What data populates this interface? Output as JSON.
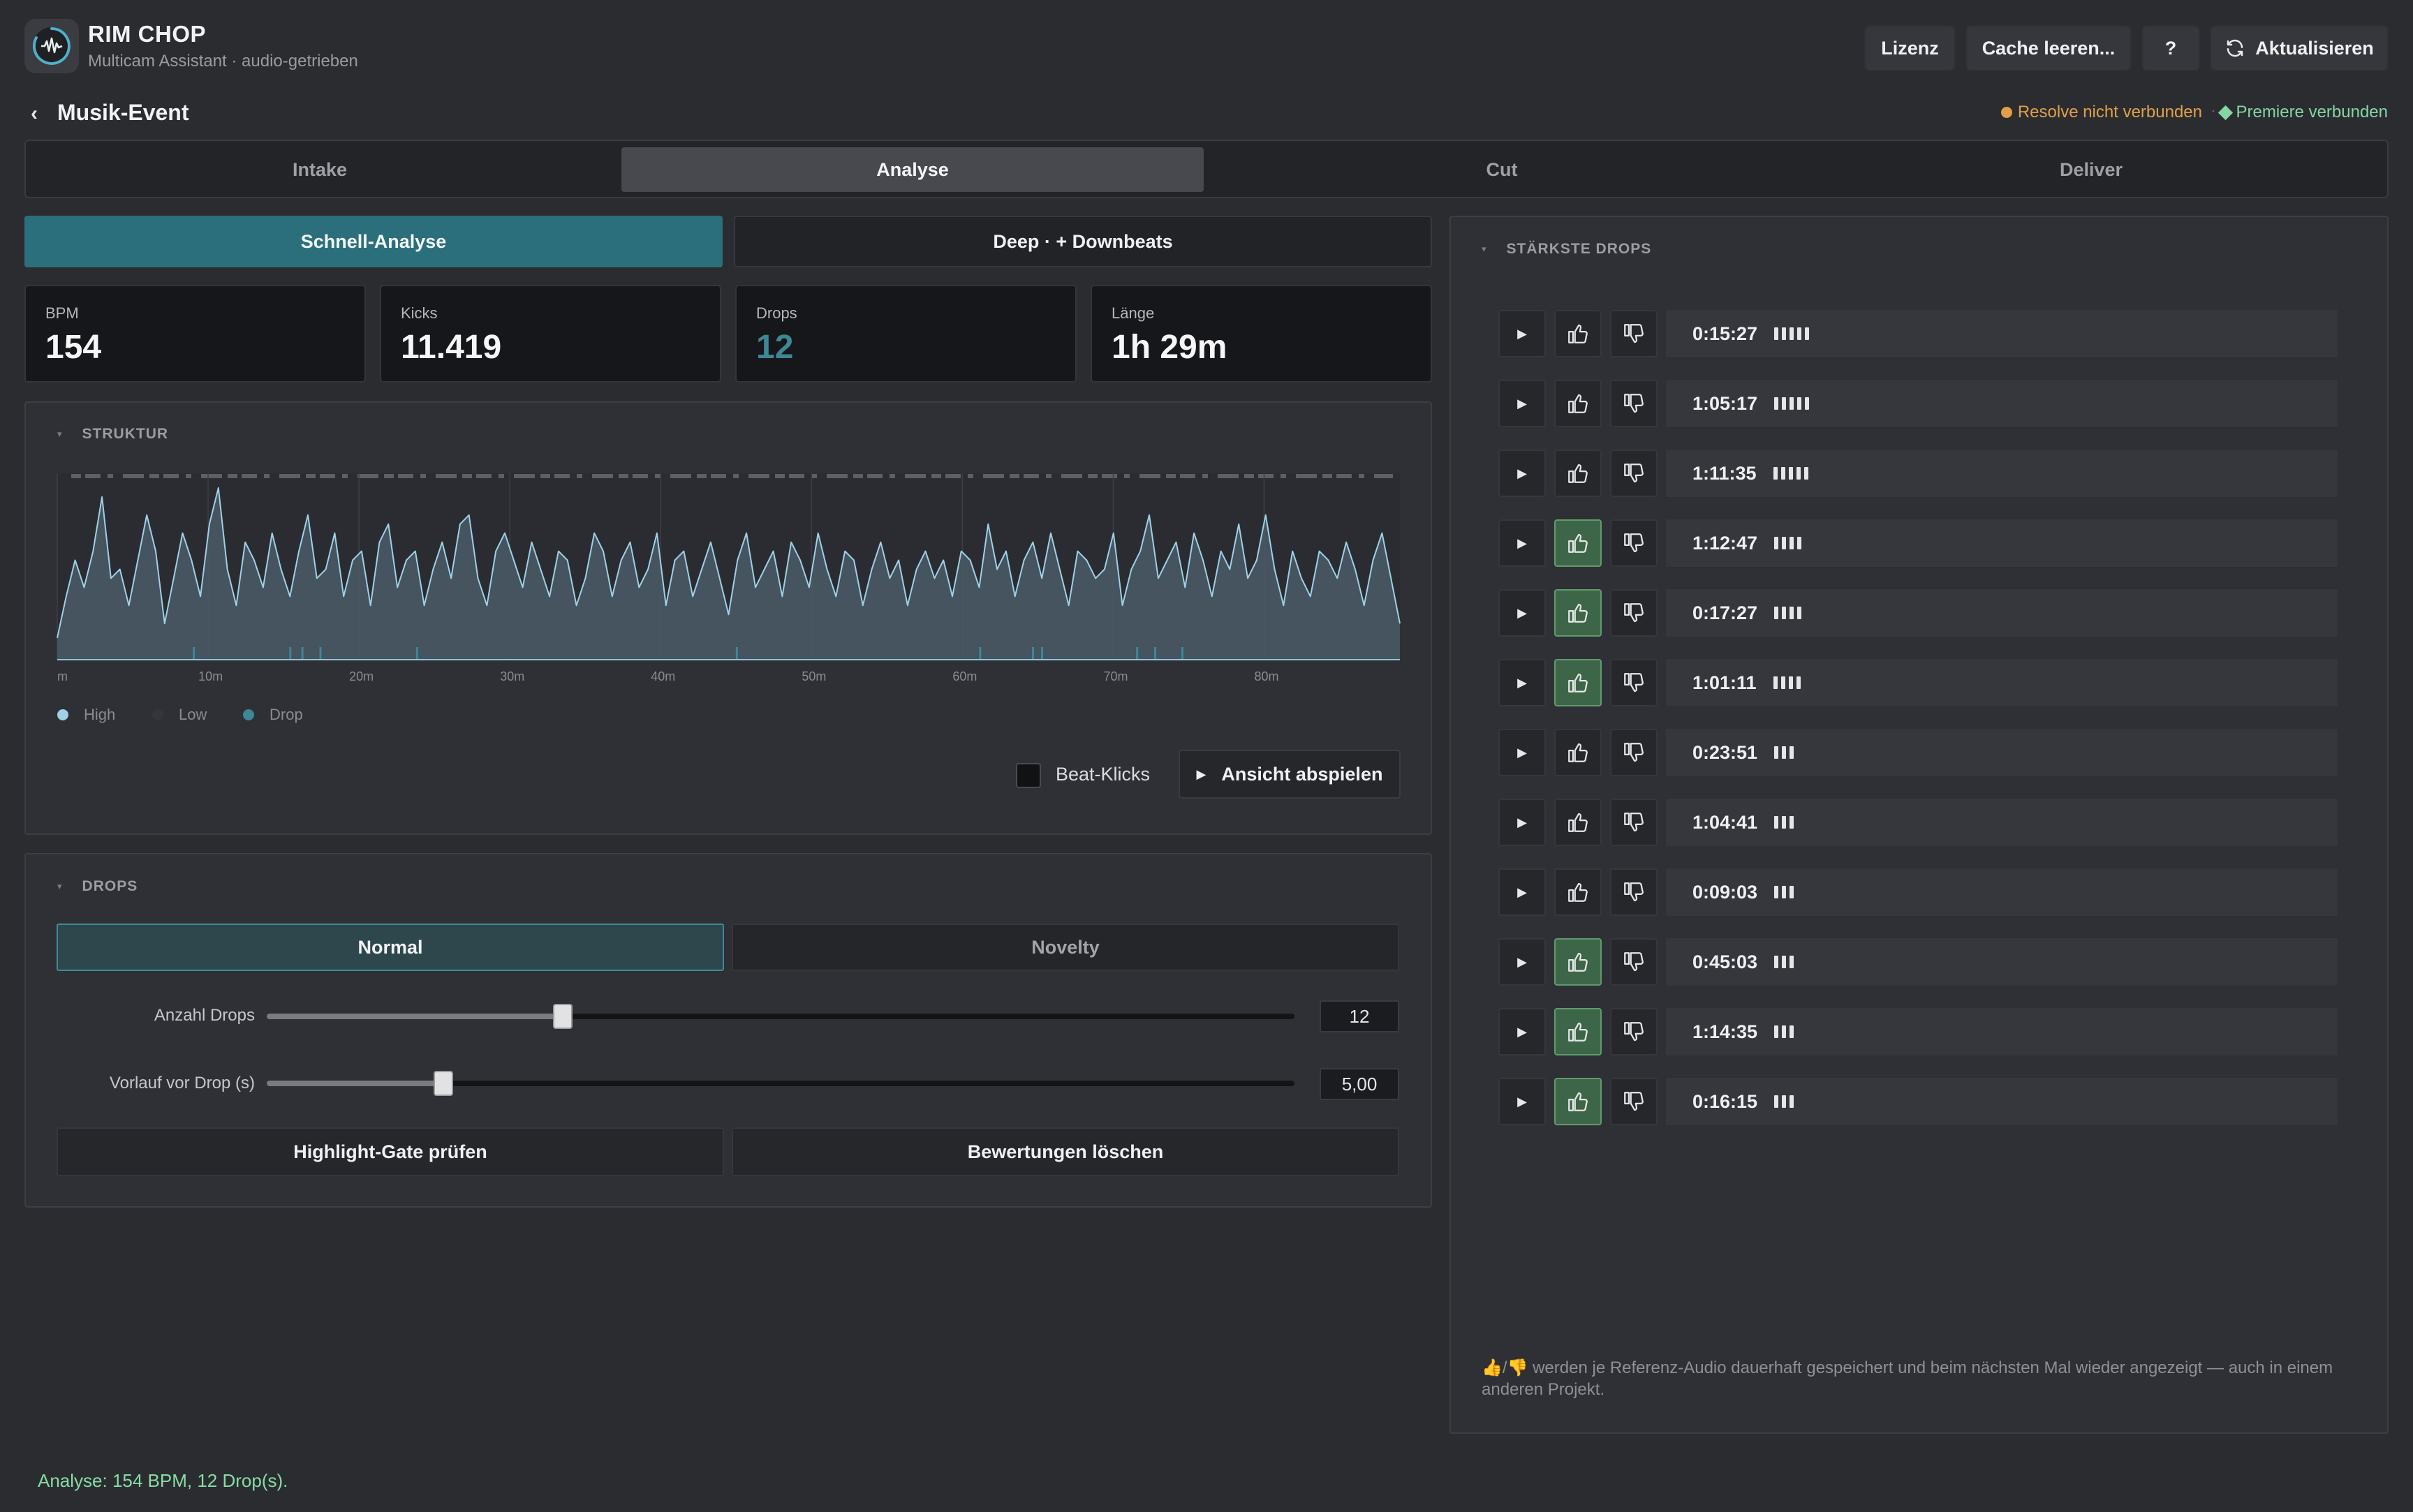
{
  "header": {
    "app_title": "RIM CHOP",
    "app_subtitle": "Multicam Assistant · audio-getrieben",
    "buttons": {
      "license": "Lizenz",
      "clear_cache": "Cache leeren...",
      "help": "?",
      "refresh": "Aktualisieren"
    }
  },
  "project": {
    "back_icon": "‹",
    "title": "Musik-Event",
    "resolve_status": "Resolve nicht verbunden",
    "separator": "·",
    "premiere_status": "Premiere verbunden",
    "resolve_color": "#e0a04a",
    "premiere_color": "#84d6a4"
  },
  "tabs": [
    {
      "label": "Intake",
      "active": false
    },
    {
      "label": "Analyse",
      "active": true
    },
    {
      "label": "Cut",
      "active": false
    },
    {
      "label": "Deliver",
      "active": false
    }
  ],
  "analysis_mode": {
    "quick": "Schnell-Analyse",
    "deep": "Deep · + Downbeats",
    "active": "quick",
    "accent": "#2b6f7c"
  },
  "stats": [
    {
      "label": "BPM",
      "value": "154",
      "color": "#f6f6f8"
    },
    {
      "label": "Kicks",
      "value": "11.419",
      "color": "#f6f6f8"
    },
    {
      "label": "Drops",
      "value": "12",
      "color": "#3d8796"
    },
    {
      "label": "Länge",
      "value": "1h 29m",
      "color": "#f6f6f8"
    }
  ],
  "structure": {
    "caret": "▾",
    "title": "STRUKTUR",
    "beat_clicks_label": "Beat-Klicks",
    "beat_clicks_checked": false,
    "play_view_label": "Ansicht abspielen",
    "legend": [
      {
        "label": "High",
        "color": "#9fd0e8"
      },
      {
        "label": "Low",
        "color": "#34363b"
      },
      {
        "label": "Drop",
        "color": "#3d8796"
      }
    ]
  },
  "chart_data": {
    "type": "area",
    "x_unit": "minutes",
    "xlim": [
      0,
      89
    ],
    "x_ticks": [
      {
        "value": 0,
        "label": "m"
      },
      {
        "value": 10,
        "label": "10m"
      },
      {
        "value": 20,
        "label": "20m"
      },
      {
        "value": 30,
        "label": "30m"
      },
      {
        "value": 40,
        "label": "40m"
      },
      {
        "value": 50,
        "label": "50m"
      },
      {
        "value": 60,
        "label": "60m"
      },
      {
        "value": 70,
        "label": "70m"
      },
      {
        "value": 80,
        "label": "80m"
      }
    ],
    "ylim": [
      0,
      1
    ],
    "series": [
      {
        "name": "High",
        "color": "#9fd0e8",
        "values": [
          0.12,
          0.35,
          0.55,
          0.4,
          0.6,
          0.9,
          0.45,
          0.5,
          0.3,
          0.55,
          0.8,
          0.6,
          0.2,
          0.45,
          0.7,
          0.55,
          0.35,
          0.75,
          0.95,
          0.5,
          0.3,
          0.65,
          0.55,
          0.4,
          0.7,
          0.5,
          0.35,
          0.6,
          0.8,
          0.45,
          0.5,
          0.7,
          0.35,
          0.55,
          0.6,
          0.3,
          0.65,
          0.75,
          0.4,
          0.55,
          0.6,
          0.3,
          0.5,
          0.65,
          0.45,
          0.75,
          0.8,
          0.45,
          0.3,
          0.6,
          0.7,
          0.55,
          0.4,
          0.65,
          0.5,
          0.35,
          0.6,
          0.55,
          0.3,
          0.45,
          0.7,
          0.6,
          0.35,
          0.55,
          0.65,
          0.4,
          0.5,
          0.7,
          0.3,
          0.55,
          0.6,
          0.35,
          0.5,
          0.65,
          0.45,
          0.25,
          0.55,
          0.7,
          0.4,
          0.5,
          0.6,
          0.35,
          0.65,
          0.55,
          0.4,
          0.7,
          0.5,
          0.35,
          0.6,
          0.55,
          0.3,
          0.5,
          0.65,
          0.45,
          0.55,
          0.3,
          0.5,
          0.6,
          0.45,
          0.55,
          0.35,
          0.6,
          0.55,
          0.4,
          0.75,
          0.5,
          0.6,
          0.35,
          0.55,
          0.65,
          0.45,
          0.7,
          0.5,
          0.3,
          0.6,
          0.55,
          0.45,
          0.5,
          0.7,
          0.3,
          0.5,
          0.6,
          0.8,
          0.45,
          0.55,
          0.65,
          0.4,
          0.7,
          0.55,
          0.35,
          0.6,
          0.5,
          0.75,
          0.45,
          0.55,
          0.8,
          0.5,
          0.3,
          0.6,
          0.45,
          0.35,
          0.6,
          0.55,
          0.45,
          0.65,
          0.5,
          0.3,
          0.55,
          0.7,
          0.45,
          0.2
        ]
      }
    ],
    "drop_markers_min": [
      15.45,
      17.45,
      16.25,
      23.85,
      9.05,
      45.05,
      61.18,
      64.68,
      65.28,
      71.58,
      72.78,
      74.58
    ]
  },
  "drops_panel": {
    "caret": "▾",
    "title": "DROPS",
    "modes": {
      "normal": "Normal",
      "novelty": "Novelty",
      "active": "normal"
    },
    "sliders": [
      {
        "label": "Anzahl Drops",
        "value": "12",
        "fraction": 0.288
      },
      {
        "label": "Vorlauf vor Drop (s)",
        "value": "5,00",
        "fraction": 0.172
      }
    ],
    "buttons": {
      "check_gate": "Highlight-Gate prüfen",
      "clear_ratings": "Bewertungen löschen"
    }
  },
  "top_drops": {
    "caret": "▾",
    "title": "STÄRKSTE DROPS",
    "play_icon": "▶",
    "items": [
      {
        "time": "0:15:27",
        "strength": 5,
        "liked": false
      },
      {
        "time": "1:05:17",
        "strength": 5,
        "liked": false
      },
      {
        "time": "1:11:35",
        "strength": 5,
        "liked": false
      },
      {
        "time": "1:12:47",
        "strength": 4,
        "liked": true
      },
      {
        "time": "0:17:27",
        "strength": 4,
        "liked": true
      },
      {
        "time": "1:01:11",
        "strength": 4,
        "liked": true
      },
      {
        "time": "0:23:51",
        "strength": 3,
        "liked": false
      },
      {
        "time": "1:04:41",
        "strength": 3,
        "liked": false
      },
      {
        "time": "0:09:03",
        "strength": 3,
        "liked": false
      },
      {
        "time": "0:45:03",
        "strength": 3,
        "liked": true
      },
      {
        "time": "1:14:35",
        "strength": 3,
        "liked": true
      },
      {
        "time": "0:16:15",
        "strength": 3,
        "liked": true
      }
    ],
    "footnote": "👍/👎 werden je Referenz-Audio dauerhaft gespeichert und beim nächsten Mal wieder angezeigt — auch in einem anderen Projekt."
  },
  "status_bar": {
    "message": "Analyse: 154 BPM, 12 Drop(s)."
  }
}
